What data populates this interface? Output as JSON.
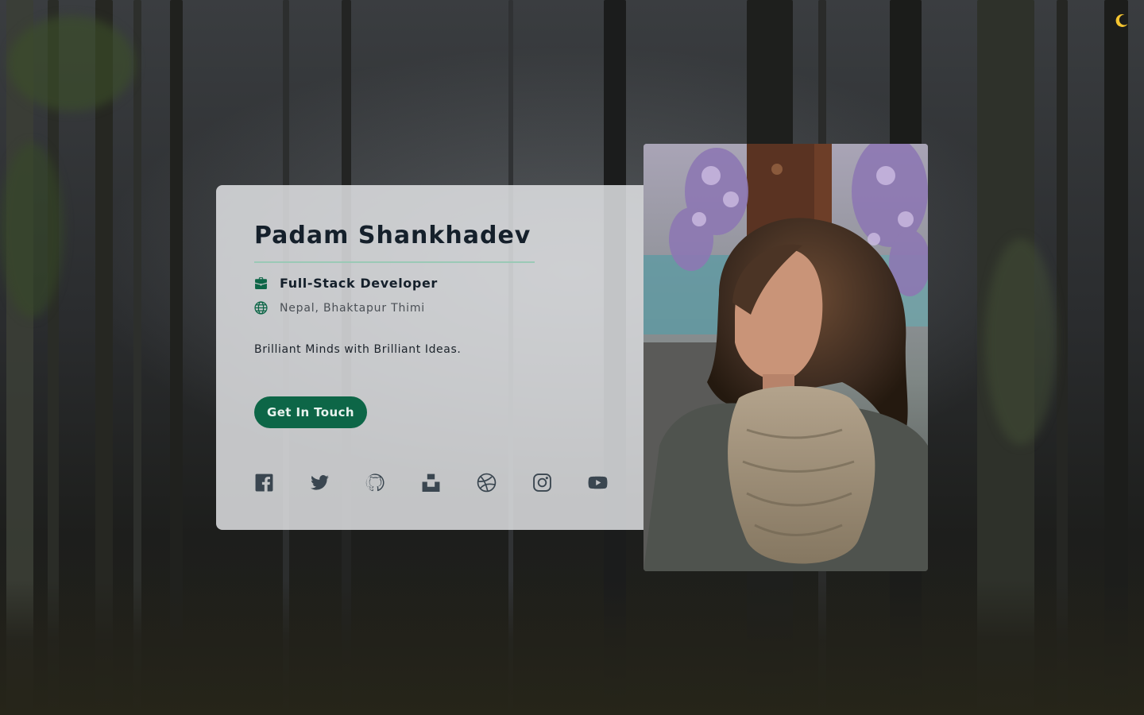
{
  "theme_toggle": {
    "icon": "moon-icon",
    "glyph": "🌙"
  },
  "profile": {
    "name": "Padam Shankhadev",
    "role": "Full-Stack Developer",
    "location": "Nepal, Bhaktapur Thimi",
    "tagline": "Brilliant Minds with Brilliant Ideas.",
    "cta_label": "Get In Touch",
    "photo_alt": "Portrait photo"
  },
  "socials": [
    {
      "icon": "facebook-icon"
    },
    {
      "icon": "twitter-icon"
    },
    {
      "icon": "github-icon"
    },
    {
      "icon": "unsplash-icon"
    },
    {
      "icon": "dribbble-icon"
    },
    {
      "icon": "instagram-icon"
    },
    {
      "icon": "youtube-icon"
    }
  ],
  "colors": {
    "accent": "#0d6647",
    "heading": "#15202b",
    "divider": "#9bc9b6",
    "social_icon": "#3a4650"
  }
}
